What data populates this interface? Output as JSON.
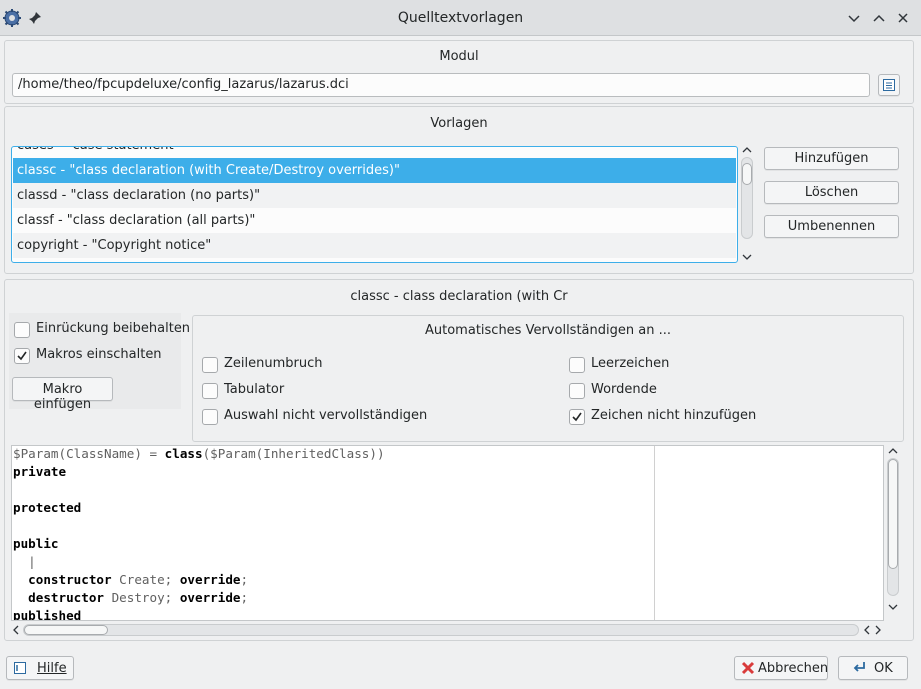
{
  "window": {
    "title": "Quelltextvorlagen"
  },
  "module": {
    "caption": "Modul",
    "path": "/home/theo/fpcupdeluxe/config_lazarus/lazarus.dci"
  },
  "templates": {
    "caption": "Vorlagen",
    "items": [
      "cases - \"case statement\"",
      "classc - \"class declaration (with Create/Destroy overrides)\"",
      "classd - \"class declaration (no parts)\"",
      "classf - \"class declaration (all parts)\"",
      "copyright - \"Copyright notice\""
    ],
    "selected_index": 1,
    "buttons": {
      "add": "Hinzufügen",
      "delete": "Löschen",
      "rename": "Umbenennen"
    }
  },
  "editor_group": {
    "caption": "classc - class declaration (with Cr",
    "keep_indent": {
      "label": "Einrückung beibehalten",
      "checked": false
    },
    "enable_macros": {
      "label": "Makros einschalten",
      "checked": true
    },
    "insert_macro": "Makro einfügen",
    "autocomplete": {
      "caption": "Automatisches Vervollständigen an ...",
      "options": [
        {
          "label": "Zeilenumbruch",
          "checked": false
        },
        {
          "label": "Leerzeichen",
          "checked": false
        },
        {
          "label": "Tabulator",
          "checked": false
        },
        {
          "label": "Wordende",
          "checked": false
        },
        {
          "label": "Auswahl nicht vervollständigen",
          "checked": false
        },
        {
          "label": "Zeichen nicht hinzufügen",
          "checked": true
        }
      ]
    }
  },
  "code": [
    [
      {
        "t": "$Param(ClassName) = ",
        "b": false
      },
      {
        "t": "class",
        "b": true
      },
      {
        "t": "($Param(InheritedClass))",
        "b": false
      }
    ],
    [
      {
        "t": "private",
        "b": true
      }
    ],
    [],
    [
      {
        "t": "protected",
        "b": true
      }
    ],
    [],
    [
      {
        "t": "public",
        "b": true
      }
    ],
    [
      {
        "t": "  |",
        "b": false
      }
    ],
    [
      {
        "t": "  ",
        "b": false
      },
      {
        "t": "constructor",
        "b": true
      },
      {
        "t": " Create; ",
        "b": false
      },
      {
        "t": "override",
        "b": true
      },
      {
        "t": ";",
        "b": false
      }
    ],
    [
      {
        "t": "  ",
        "b": false
      },
      {
        "t": "destructor",
        "b": true
      },
      {
        "t": " Destroy; ",
        "b": false
      },
      {
        "t": "override",
        "b": true
      },
      {
        "t": ";",
        "b": false
      }
    ],
    [
      {
        "t": "published",
        "b": true
      }
    ]
  ],
  "footer": {
    "help": "Hilfe",
    "cancel": "Abbrechen",
    "ok": "OK"
  },
  "colors": {
    "selection": "#3daee9",
    "window_bg": "#eff0f1"
  }
}
